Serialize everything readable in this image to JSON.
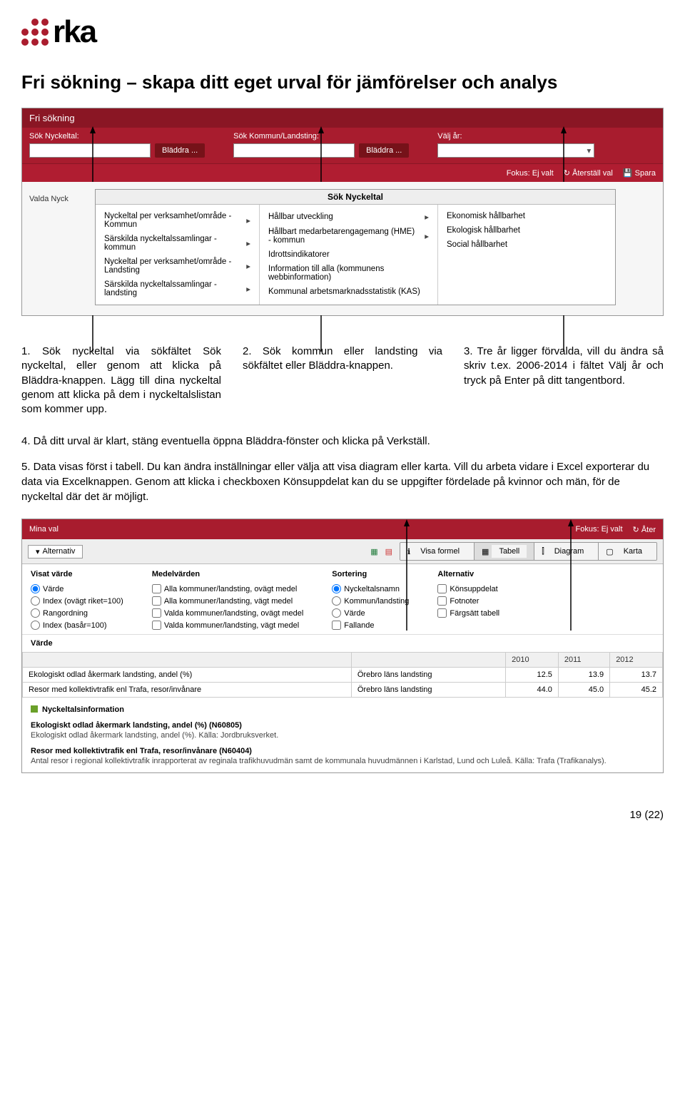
{
  "logo_text": "rka",
  "title": "Fri sökning – skapa ditt eget urval för jämförelser och analys",
  "scr1": {
    "heading": "Fri sökning",
    "lbl_nyckeltal": "Sök Nyckeltal:",
    "lbl_kommun": "Sök Kommun/Landsting:",
    "lbl_ar": "Välj år:",
    "btn_bladdra": "Bläddra ...",
    "tool_fokus": "Fokus: Ej valt",
    "tool_aterstall": "Återställ val",
    "tool_spara": "Spara",
    "side_label": "Valda Nyck",
    "panel_title": "Sök Nyckeltal",
    "col1": [
      "Nyckeltal per verksamhet/område - Kommun",
      "Särskilda nyckeltalssamlingar - kommun",
      "Nyckeltal per verksamhet/område - Landsting",
      "Särskilda nyckeltalssamlingar - landsting"
    ],
    "col2": [
      "Hållbar utveckling",
      "Hållbart medarbetarengagemang (HME) - kommun",
      "Idrottsindikatorer",
      "Information till alla (kommunens webbinformation)",
      "Kommunal arbetsmarknadsstatistik (KAS)"
    ],
    "col3": [
      "Ekonomisk hållbarhet",
      "Ekologisk hållbarhet",
      "Social hållbarhet"
    ]
  },
  "step1": "1. Sök nyckeltal via sökfältet Sök nyckeltal, eller genom att klicka på Bläddra-knappen. Lägg till dina nyckeltal genom att klicka på dem i nyckeltalslistan som kommer upp.",
  "step2": "2. Sök kommun eller landsting via sökfältet eller Bläddra-knappen.",
  "step3": "3. Tre år ligger förvalda, vill du ändra så skriv t.ex. 2006-2014 i fältet Välj år och tryck på Enter på ditt tangentbord.",
  "step4": "4. Då ditt urval är klart, stäng eventuella öppna Bläddra-fönster och klicka på Verkställ.",
  "step5": "5. Data visas först i tabell. Du kan ändra inställningar eller välja att visa diagram eller karta. Vill du arbeta vidare i Excel exporterar du data via Excelknappen. Genom att klicka i checkboxen Könsuppdelat kan du se uppgifter fördelade på kvinnor och män, för de nyckeltal där det är möjligt.",
  "scr2": {
    "mina_val": "Mina val",
    "fokus": "Fokus: Ej valt",
    "ater": "Åter",
    "alternativ": "Alternativ",
    "visa_formel": "Visa formel",
    "tabell": "Tabell",
    "diagram": "Diagram",
    "karta": "Karta",
    "h_visat": "Visat värde",
    "h_medel": "Medelvärden",
    "h_sort": "Sortering",
    "h_alt": "Alternativ",
    "visat": [
      "Värde",
      "Index (ovägt riket=100)",
      "Rangordning",
      "Index (basår=100)"
    ],
    "medel": [
      "Alla kommuner/landsting, ovägt medel",
      "Alla kommuner/landsting, vägt medel",
      "Valda kommuner/landsting, ovägt medel",
      "Valda kommuner/landsting, vägt medel"
    ],
    "sort": [
      "Nyckeltalsnamn",
      "Kommun/landsting",
      "Värde",
      "Fallande"
    ],
    "altopts": [
      "Könsuppdelat",
      "Fotnoter",
      "Färgsätt tabell"
    ],
    "varde_head": "Värde",
    "years": [
      "2010",
      "2011",
      "2012"
    ],
    "rows": [
      {
        "n": "Ekologiskt odlad åkermark landsting, andel (%)",
        "r": "Örebro läns landsting",
        "v": [
          "12.5",
          "13.9",
          "13.7"
        ]
      },
      {
        "n": "Resor med kollektivtrafik enl Trafa, resor/invånare",
        "r": "Örebro läns landsting",
        "v": [
          "44.0",
          "45.0",
          "45.2"
        ]
      }
    ],
    "info_title": "Nyckeltalsinformation",
    "info1_h": "Ekologiskt odlad åkermark landsting, andel (%) (N60805)",
    "info1_p": "Ekologiskt odlad åkermark landsting, andel (%). Källa: Jordbruksverket.",
    "info2_h": "Resor med kollektivtrafik enl Trafa, resor/invånare (N60404)",
    "info2_p": "Antal resor i regional kollektivtrafik inrapporterat av reginala trafikhuvudmän samt de kommunala huvudmännen i Karlstad, Lund och Luleå. Källa: Trafa (Trafikanalys)."
  },
  "pagenum": "19 (22)"
}
